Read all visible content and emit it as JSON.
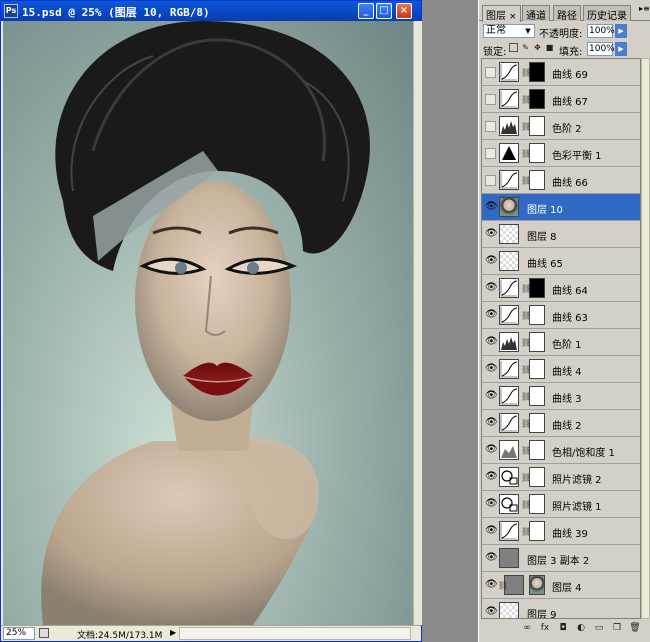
{
  "document": {
    "title": "15.psd @ 25% (图层 10, RGB/8)",
    "icon_text": "Ps",
    "zoom": "25%",
    "info": "文档:24.5M/173.1M"
  },
  "panel": {
    "tabs": [
      {
        "label": "图层",
        "close": "×"
      },
      {
        "label": "通道"
      },
      {
        "label": "路径"
      },
      {
        "label": "历史记录"
      }
    ],
    "blend_mode": "正常",
    "opacity_label": "不透明度:",
    "opacity_value": "100%",
    "lock_label": "锁定:",
    "fill_label": "填充:",
    "fill_value": "100%"
  },
  "layers": [
    {
      "name": "曲线 69",
      "visible": false,
      "thumb": "curves",
      "mask": "dark"
    },
    {
      "name": "曲线 67",
      "visible": false,
      "thumb": "curves",
      "mask": "dark"
    },
    {
      "name": "色阶 2",
      "visible": false,
      "thumb": "levels",
      "mask": "white"
    },
    {
      "name": "色彩平衡 1",
      "visible": false,
      "thumb": "balance",
      "mask": "white"
    },
    {
      "name": "曲线 66",
      "visible": false,
      "thumb": "curves",
      "mask": "white"
    },
    {
      "name": "图层 10",
      "visible": true,
      "thumb": "photo",
      "mask": null,
      "selected": true
    },
    {
      "name": "图层 8",
      "visible": true,
      "thumb": "transparent",
      "mask": null
    },
    {
      "name": "曲线 65",
      "visible": true,
      "thumb": "transparent",
      "mask": null
    },
    {
      "name": "曲线 64",
      "visible": true,
      "thumb": "curves",
      "mask": "dark"
    },
    {
      "name": "曲线 63",
      "visible": true,
      "thumb": "curves",
      "mask": "white"
    },
    {
      "name": "色阶 1",
      "visible": true,
      "thumb": "levels",
      "mask": "white"
    },
    {
      "name": "曲线 4",
      "visible": true,
      "thumb": "curves",
      "mask": "white"
    },
    {
      "name": "曲线 3",
      "visible": true,
      "thumb": "curves",
      "mask": "white"
    },
    {
      "name": "曲线 2",
      "visible": true,
      "thumb": "curves",
      "mask": "white"
    },
    {
      "name": "色相/饱和度 1",
      "visible": true,
      "thumb": "hue",
      "mask": "white"
    },
    {
      "name": "照片滤镜 2",
      "visible": true,
      "thumb": "filter",
      "mask": "white"
    },
    {
      "name": "照片滤镜 1",
      "visible": true,
      "thumb": "filter",
      "mask": "white"
    },
    {
      "name": "曲线 39",
      "visible": true,
      "thumb": "curves",
      "mask": "white"
    },
    {
      "name": "图层 3 副本 2",
      "visible": true,
      "thumb": "gray",
      "mask": null
    },
    {
      "name": "图层 4",
      "visible": true,
      "thumb": "gray",
      "mask": "photo"
    },
    {
      "name": "图层 9",
      "visible": true,
      "thumb": "transparent",
      "mask": null
    }
  ],
  "colors": {
    "titlebar": "#0a5bd8",
    "selection": "#316ac5",
    "lips": "#7a0f12",
    "hair": "#1a1a1a"
  }
}
